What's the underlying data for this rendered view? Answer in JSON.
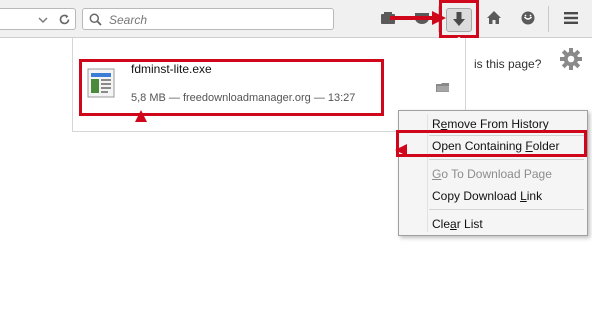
{
  "search": {
    "placeholder": "Search"
  },
  "toolbar": {
    "icons": [
      "dropmarker-icon",
      "reload-icon",
      "search-icon",
      "bookmarks-icon",
      "pocket-icon",
      "download-icon",
      "home-icon",
      "chat-icon",
      "menu-icon"
    ]
  },
  "downloads": {
    "item": {
      "filename": "fdminst-lite.exe",
      "status": "5,8 MB — freedownloadmanager.org — 13:27"
    }
  },
  "page": {
    "question": "is this page?"
  },
  "context_menu": {
    "items": [
      {
        "label": "Remove From History",
        "accesskey": "e",
        "enabled": true
      },
      {
        "label": "Open Containing Folder",
        "accesskey": "F",
        "enabled": true
      },
      {
        "label": "Go To Download Page",
        "accesskey": "G",
        "enabled": false
      },
      {
        "label": "Copy Download Link",
        "accesskey": "L",
        "enabled": true
      },
      {
        "label": "Clear List",
        "accesskey": "a",
        "enabled": true
      }
    ]
  },
  "colors": {
    "highlight": "#d0061b",
    "toolbar": "#f0f0f0",
    "menu_bg": "#f5f5f5"
  }
}
